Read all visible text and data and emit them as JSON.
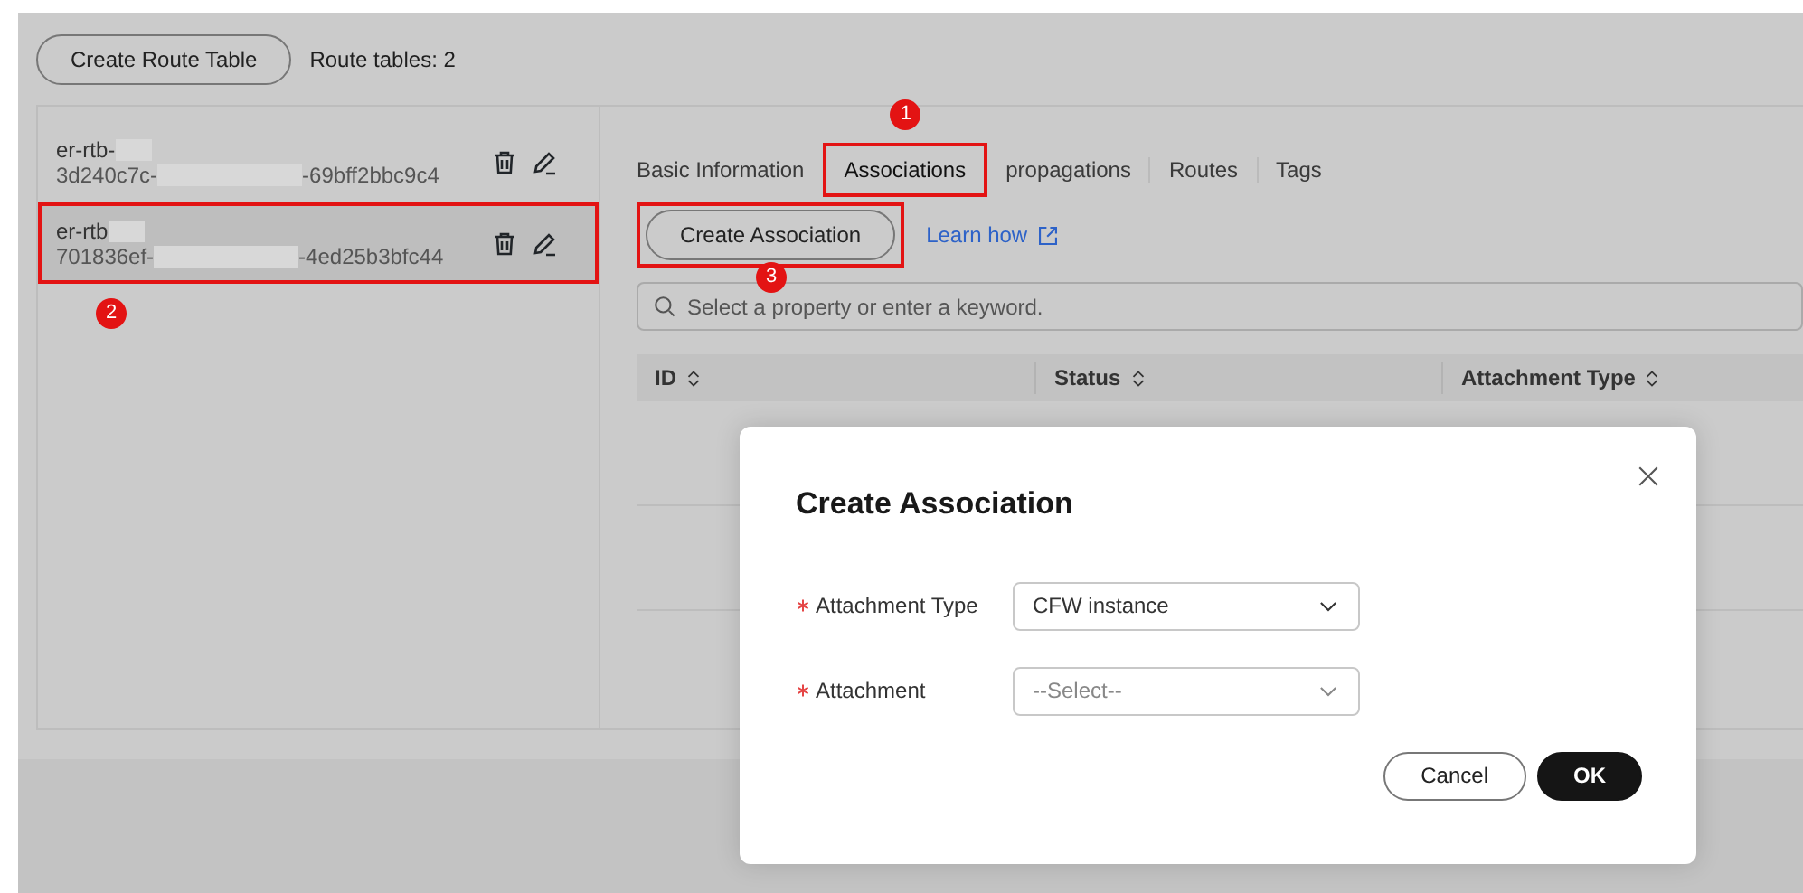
{
  "header": {
    "create_button": "Create Route Table",
    "count": "Route tables: 2"
  },
  "route_tables": [
    {
      "name": "er-rtb-",
      "id_start": "3d240c7c-",
      "id_end": "-69bff2bbc9c4",
      "selected": false,
      "highlighted": false
    },
    {
      "name": "er-rtb",
      "id_start": "701836ef-",
      "id_end": "-4ed25b3bfc44",
      "selected": true,
      "highlighted": true,
      "step": "2"
    }
  ],
  "tabs": [
    {
      "label": "Basic Information",
      "selected": false,
      "highlighted": false
    },
    {
      "label": "Associations",
      "selected": true,
      "highlighted": true,
      "step": "1"
    },
    {
      "label": "propagations",
      "selected": false,
      "highlighted": false
    },
    {
      "label": "Routes",
      "selected": false,
      "highlighted": false
    },
    {
      "label": "Tags",
      "selected": false,
      "highlighted": false
    }
  ],
  "toolbar": {
    "create_button": "Create Association",
    "highlighted": true,
    "step": "3",
    "link": "Learn how"
  },
  "search": {
    "placeholder": "Select a property or enter a keyword."
  },
  "table": {
    "columns": [
      "ID",
      "Status",
      "Attachment Type"
    ]
  },
  "dialog": {
    "title": "Create Association",
    "fields": [
      {
        "label": "Attachment Type",
        "required": true,
        "value": "CFW instance"
      },
      {
        "label": "Attachment",
        "required": true,
        "placeholder": "--Select--"
      }
    ],
    "buttons": [
      {
        "label": "Cancel",
        "kind": "secondary"
      },
      {
        "label": "OK",
        "kind": "primary"
      }
    ]
  }
}
